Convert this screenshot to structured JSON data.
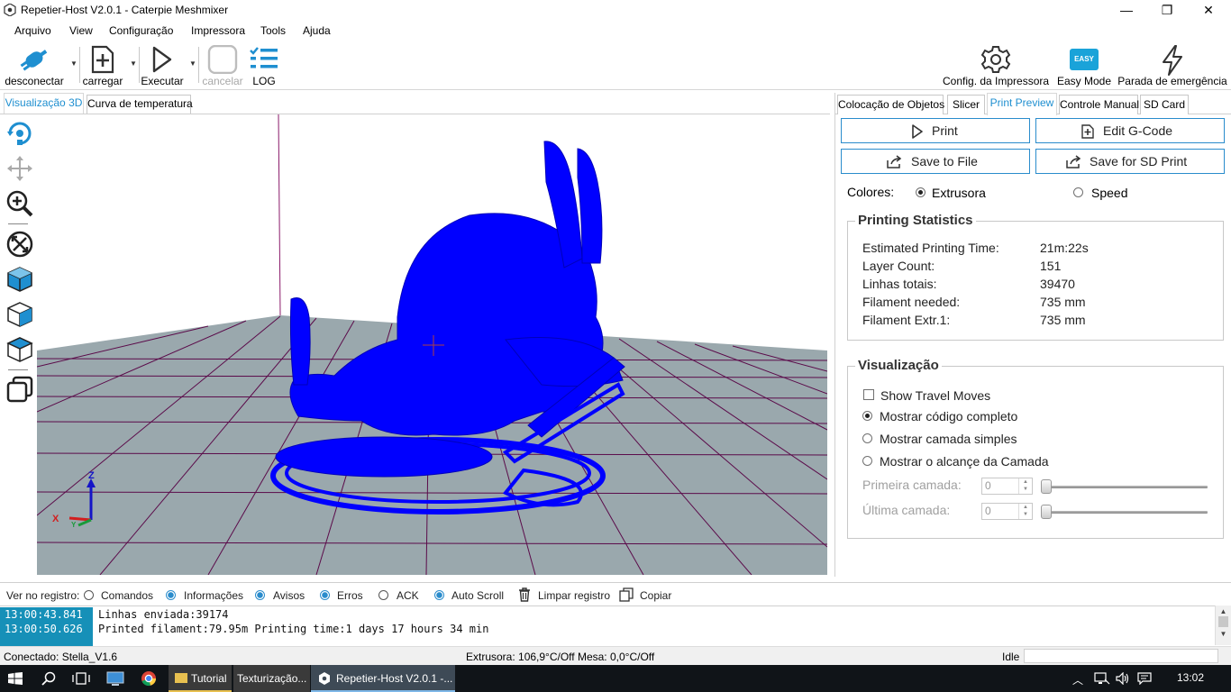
{
  "window": {
    "title": "Repetier-Host V2.0.1 - Caterpie Meshmixer",
    "minimize_glyph": "—",
    "maximize_glyph": "❐",
    "close_glyph": "✕"
  },
  "menu": [
    "Arquivo",
    "View",
    "Configuração",
    "Impressora",
    "Tools",
    "Ajuda"
  ],
  "toolbar": {
    "disconnect": "desconectar",
    "load": "carregar",
    "execute": "Executar",
    "cancel": "cancelar",
    "log": "LOG",
    "printer_settings": "Config. da Impressora",
    "easy_mode": "Easy Mode",
    "easy_badge": "EASY",
    "emergency_stop": "Parada de emergência"
  },
  "left_tabs": [
    "Visualização 3D",
    "Curva de temperatura"
  ],
  "view_tools": [
    "rotate-icon",
    "move-icon",
    "zoom-icon",
    "fit-view-icon",
    "iso-view-icon",
    "front-view-icon",
    "top-view-icon",
    "parallel-view-icon"
  ],
  "axes": {
    "x": "X",
    "y": "Y",
    "z": "Z"
  },
  "right_tabs": [
    "Colocação de Objetos",
    "Slicer",
    "Print Preview",
    "Controle Manual",
    "SD Card"
  ],
  "preview": {
    "print": "Print",
    "edit_gcode": "Edit G-Code",
    "save_file": "Save to File",
    "save_sd": "Save for SD Print",
    "colors_label": "Colores:",
    "color_extruder": "Extrusora",
    "color_speed": "Speed"
  },
  "stats": {
    "title": "Printing Statistics",
    "rows": [
      {
        "label": "Estimated Printing Time:",
        "value": "21m:22s"
      },
      {
        "label": "Layer Count:",
        "value": "151"
      },
      {
        "label": "Linhas totais:",
        "value": "39470"
      },
      {
        "label": "Filament needed:",
        "value": "735 mm"
      },
      {
        "label": "Filament Extr.1:",
        "value": "735 mm"
      }
    ]
  },
  "visualization": {
    "title": "Visualização",
    "travel": "Show Travel Moves",
    "full": "Mostrar código completo",
    "single": "Mostrar camada simples",
    "range": "Mostrar o alcançe da Camada",
    "first_layer": "Primeira camada:",
    "last_layer": "Última camada:",
    "first_value": "0",
    "last_value": "0"
  },
  "logbar": {
    "label": "Ver no registro:",
    "commands": "Comandos",
    "info": "Informações",
    "warnings": "Avisos",
    "errors": "Erros",
    "ack": "ACK",
    "autoscroll": "Auto Scroll",
    "clear": "Limpar registro",
    "copy": "Copiar"
  },
  "log": [
    {
      "time": "13:00:43.841",
      "msg": "Linhas enviada:39174"
    },
    {
      "time": "13:00:50.626",
      "msg": "Printed filament:79.95m Printing time:1 days 17 hours 34 min"
    }
  ],
  "status": {
    "connection": "Conectado: Stella_V1.6",
    "temps": "Extrusora: 106,9°C/Off Mesa: 0,0°C/Off",
    "state": "Idle"
  },
  "taskbar": {
    "item1": "Tutorial",
    "item2": "Texturização...",
    "item3": "Repetier-Host V2.0.1 -...",
    "clock": "13:02"
  },
  "colors": {
    "model": "#0000ff",
    "bed": "#9aa8ad",
    "grid": "#5b0b4a",
    "accent": "#1f8fd0"
  }
}
